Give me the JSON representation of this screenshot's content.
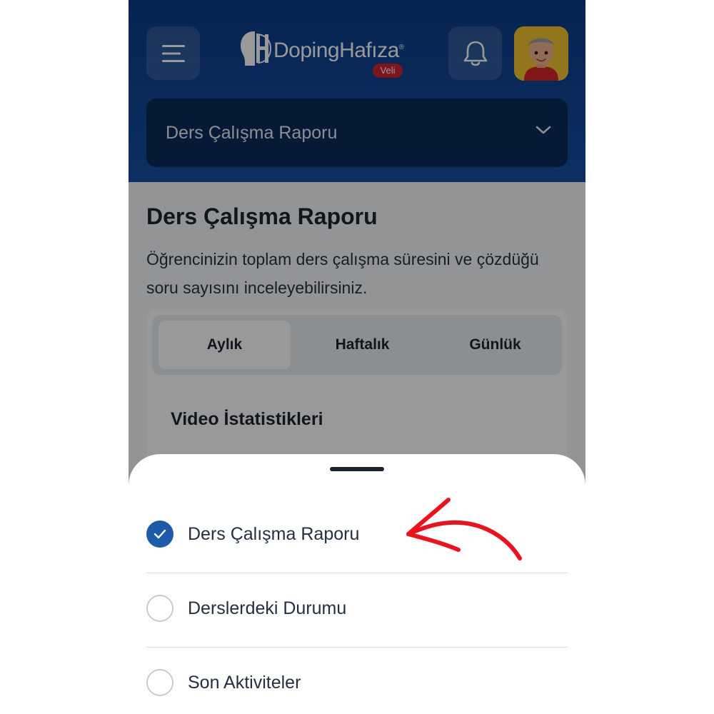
{
  "header": {
    "logo_text": "DopingHafıza",
    "logo_mark": "®",
    "logo_badge": "Veli",
    "selected_report": "Ders Çalışma Raporu"
  },
  "page": {
    "title": "Ders Çalışma Raporu",
    "description": "Öğrencinizin toplam ders çalışma süresini ve çözdüğü soru sayısını inceleyebilirsiniz."
  },
  "tabs": [
    {
      "label": "Aylık",
      "active": true
    },
    {
      "label": "Haftalık",
      "active": false
    },
    {
      "label": "Günlük",
      "active": false
    }
  ],
  "section": {
    "title": "Video İstatistikleri"
  },
  "sheet": {
    "options": [
      {
        "label": "Ders Çalışma Raporu",
        "selected": true
      },
      {
        "label": "Derslerdeki Durumu",
        "selected": false
      },
      {
        "label": "Son Aktiviteler",
        "selected": false
      }
    ]
  },
  "icons": [
    "menu-icon",
    "logo-icon",
    "bell-icon",
    "avatar",
    "chevron-down-icon",
    "check-icon",
    "red-arrow-annotation"
  ],
  "colors": {
    "header_bg": "#154ea4",
    "select_bg": "#0a2a5a",
    "logo_badge_bg": "#d0262d",
    "accent": "#1f5aa8",
    "annotation": "#e8141d"
  }
}
